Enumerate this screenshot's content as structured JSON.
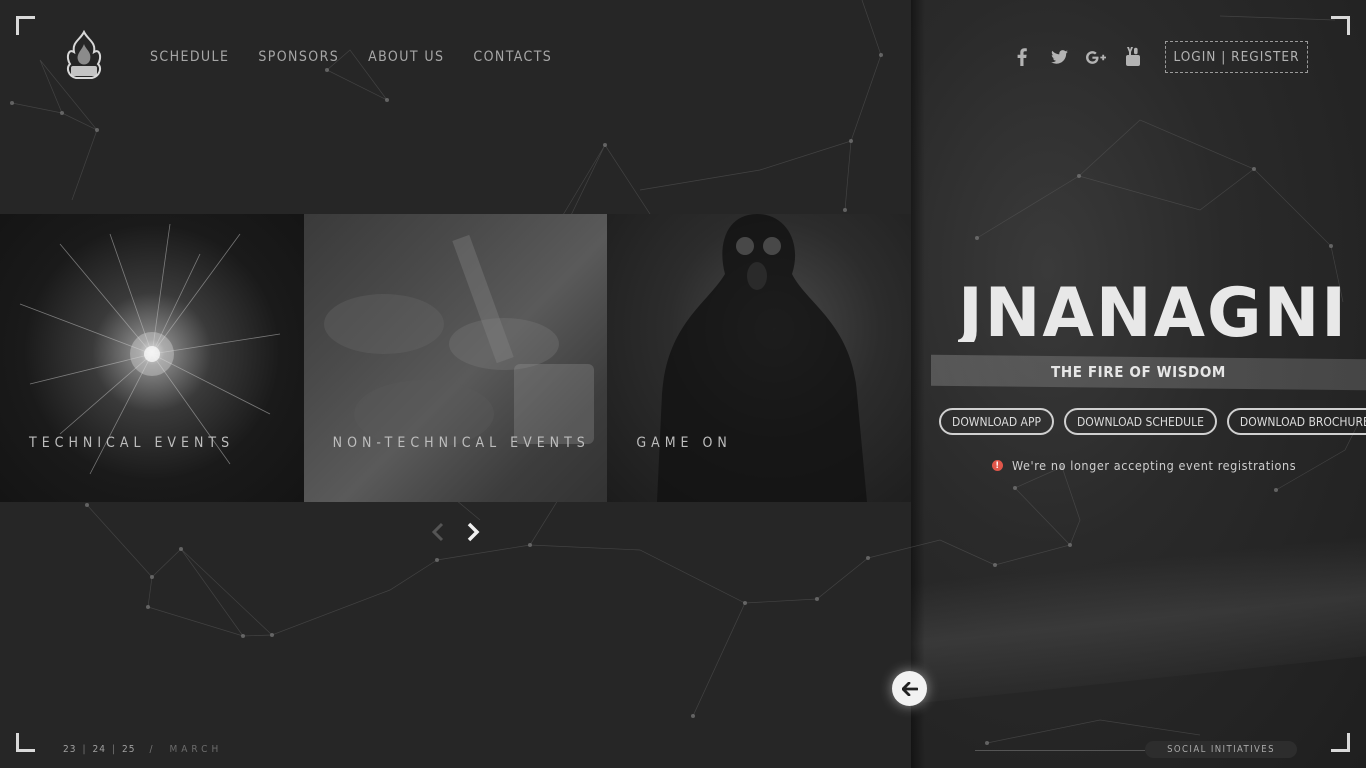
{
  "nav": {
    "items": [
      "SCHEDULE",
      "SPONSORS",
      "ABOUT US",
      "CONTACTS"
    ]
  },
  "social": {
    "icons": [
      "facebook-icon",
      "twitter-icon",
      "google-plus-icon",
      "youtube-icon"
    ]
  },
  "auth": {
    "label": "LOGIN | REGISTER"
  },
  "cards": [
    {
      "label": "TECHNICAL EVENTS"
    },
    {
      "label": "NON-TECHNICAL EVENTS"
    },
    {
      "label": "GAME ON"
    }
  ],
  "hero": {
    "brand": "JNANAGNI",
    "tagline": "THE FIRE OF WISDOM",
    "buttons": [
      "DOWNLOAD APP",
      "DOWNLOAD SCHEDULE",
      "DOWNLOAD BROCHURE"
    ],
    "notice": "We're no longer accepting event registrations"
  },
  "footer": {
    "dates": [
      "23",
      "24",
      "25"
    ],
    "month": "MARCH",
    "social_initiatives": "SOCIAL INITIATIVES"
  },
  "colors": {
    "background": "#262626",
    "accent_alert": "#e0564a",
    "text": "#bfbfbf"
  }
}
